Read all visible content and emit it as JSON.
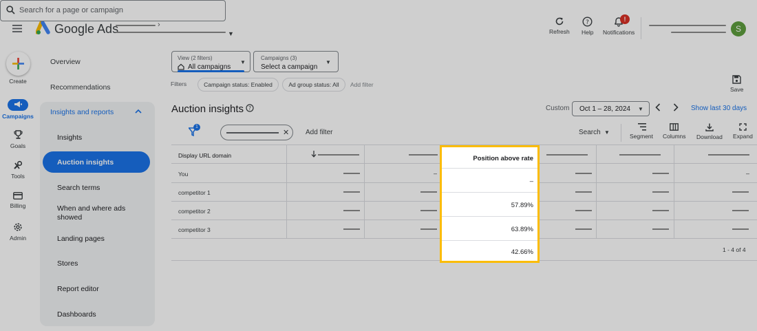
{
  "app": {
    "logo_text": "Google Ads",
    "avatar_initial": "S"
  },
  "search": {
    "placeholder": "Search for a page or campaign"
  },
  "top_actions": {
    "refresh": "Refresh",
    "help": "Help",
    "notifications": "Notifications",
    "notification_badge": "!"
  },
  "rail": {
    "create": "Create",
    "items": [
      {
        "label": "Campaigns",
        "icon": "megaphone-icon",
        "active": true
      },
      {
        "label": "Goals",
        "icon": "trophy-icon"
      },
      {
        "label": "Tools",
        "icon": "wrench-icon"
      },
      {
        "label": "Billing",
        "icon": "credit-card-icon"
      },
      {
        "label": "Admin",
        "icon": "gear-icon"
      }
    ]
  },
  "nav": {
    "overview": "Overview",
    "recommendations": "Recommendations",
    "section": "Insights and reports",
    "sub_items": [
      "Insights",
      "Auction insights",
      "Search terms",
      "When and where ads showed",
      "Landing pages",
      "Stores",
      "Report editor",
      "Dashboards"
    ],
    "selected": "Auction insights"
  },
  "view_selector": {
    "label": "View (2 filters)",
    "value": "All campaigns"
  },
  "campaign_selector": {
    "label": "Campaigns (3)",
    "value": "Select a campaign"
  },
  "filters": {
    "label": "Filters",
    "chips": [
      "Campaign status: Enabled",
      "Ad group status: All"
    ],
    "add": "Add filter"
  },
  "save_label": "Save",
  "page_title": "Auction insights",
  "date": {
    "custom_label": "Custom",
    "range": "Oct 1 – 28, 2024",
    "show_last": "Show last 30 days"
  },
  "toolbar": {
    "filter_count": "1",
    "add_filter": "Add filter",
    "search": "Search",
    "segment": "Segment",
    "columns": "Columns",
    "download": "Download",
    "expand": "Expand"
  },
  "table": {
    "first_column": "Display URL domain",
    "rows": [
      "You",
      "competitor 1",
      "competitor 2",
      "competitor 3"
    ],
    "you_value": "–",
    "pagination": "1 - 4 of 4"
  },
  "highlight": {
    "header": "Position above rate",
    "values": [
      "–",
      "57.89%",
      "63.89%",
      "42.66%"
    ],
    "border_color": "#fbbc04"
  },
  "colors": {
    "brand_blue": "#1a73e8",
    "avatar_green": "#5e9e3e",
    "badge_red": "#d93025"
  }
}
